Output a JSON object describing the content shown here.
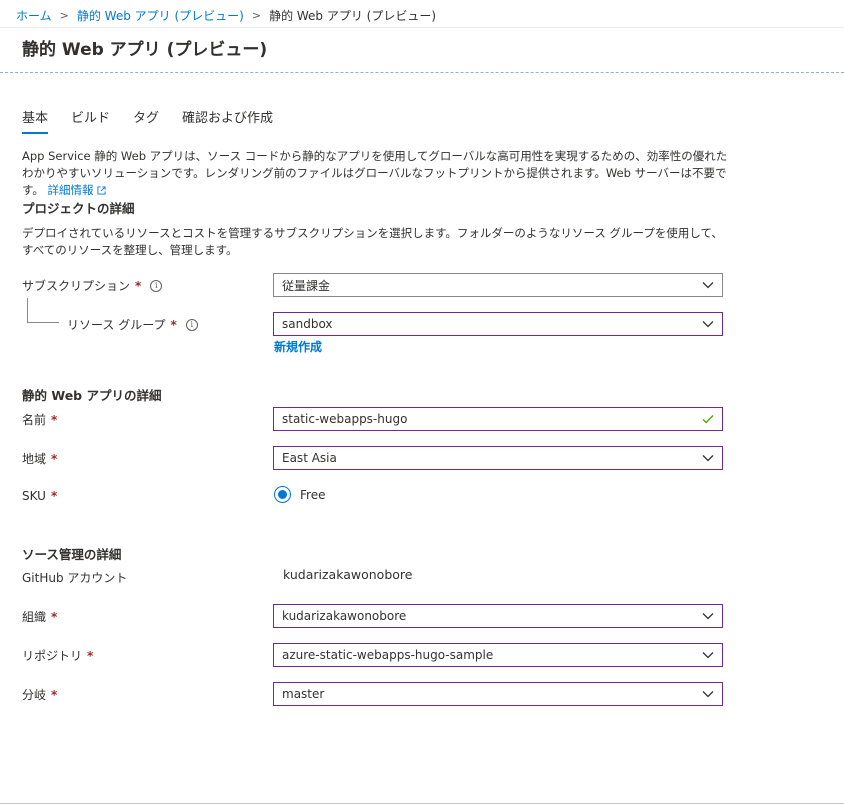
{
  "breadcrumb": {
    "home": "ホーム",
    "parent": "静的 Web アプリ (プレビュー)",
    "current": "静的 Web アプリ (プレビュー)"
  },
  "page_title": "静的 Web アプリ (プレビュー)",
  "tabs": [
    {
      "label": "基本",
      "active": true
    },
    {
      "label": "ビルド",
      "active": false
    },
    {
      "label": "タグ",
      "active": false
    },
    {
      "label": "確認および作成",
      "active": false
    }
  ],
  "intro": {
    "text": "App Service 静的 Web アプリは、ソース コードから静的なアプリを使用してグローバルな高可用性を実現するための、効率性の優れたわかりやすいソリューションです。レンダリング前のファイルはグローバルなフットプリントから提供されます。Web サーバーは不要です。",
    "link_label": "詳細情報"
  },
  "project": {
    "heading": "プロジェクトの詳細",
    "description": "デプロイされているリソースとコストを管理するサブスクリプションを選択します。フォルダーのようなリソース グループを使用して、すべてのリソースを整理し、管理します。",
    "subscription_label": "サブスクリプション",
    "subscription_value": "従量課金",
    "resource_group_label": "リソース グループ",
    "resource_group_value": "sandbox",
    "create_new_label": "新規作成"
  },
  "app": {
    "heading": "静的 Web アプリの詳細",
    "name_label": "名前",
    "name_value": "static-webapps-hugo",
    "region_label": "地域",
    "region_value": "East Asia",
    "sku_label": "SKU",
    "sku_option": "Free"
  },
  "source": {
    "heading": "ソース管理の詳細",
    "account_label": "GitHub アカウント",
    "account_value": "kudarizakawonobore",
    "org_label": "組織",
    "org_value": "kudarizakawonobore",
    "repo_label": "リポジトリ",
    "repo_value": "azure-static-webapps-hugo-sample",
    "branch_label": "分岐",
    "branch_value": "master"
  },
  "required_marker": "*",
  "info_glyph": "i",
  "colors": {
    "accent": "#0078d4",
    "required": "#a4262c",
    "validated_border": "#6c2a96",
    "success_check": "#57a300"
  }
}
